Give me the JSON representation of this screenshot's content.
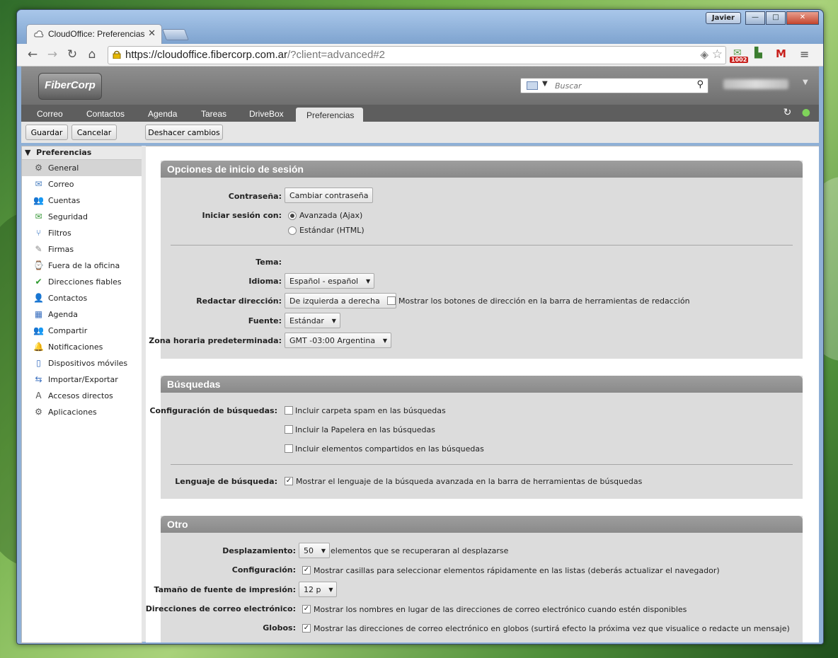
{
  "window": {
    "user_badge": "Javier",
    "min": "—",
    "max": "□",
    "close": "✕"
  },
  "browser": {
    "tab_title": "CloudOffice: Preferencias",
    "tab_close": "✕",
    "url_domain": "https://cloudoffice.fibercorp.com.ar",
    "url_rest": "/?client=advanced#2",
    "ext_badge": "1002"
  },
  "app": {
    "logo": "FiberCorp",
    "search_placeholder": "Buscar",
    "nav_tabs": [
      "Correo",
      "Contactos",
      "Agenda",
      "Tareas",
      "DriveBox",
      "Preferencias"
    ],
    "actions": {
      "save": "Guardar",
      "cancel": "Cancelar",
      "undo": "Deshacer cambios"
    }
  },
  "sidebar": {
    "header": "Preferencias",
    "items": [
      {
        "label": "General",
        "icon": "gear-icon",
        "glyph": "⚙"
      },
      {
        "label": "Correo",
        "icon": "mail-icon",
        "glyph": "✉"
      },
      {
        "label": "Cuentas",
        "icon": "accounts-icon",
        "glyph": "👥"
      },
      {
        "label": "Seguridad",
        "icon": "security-icon",
        "glyph": "✉"
      },
      {
        "label": "Filtros",
        "icon": "filter-icon",
        "glyph": "⑂"
      },
      {
        "label": "Firmas",
        "icon": "signature-icon",
        "glyph": "✎"
      },
      {
        "label": "Fuera de la oficina",
        "icon": "out-of-office-icon",
        "glyph": "⌚"
      },
      {
        "label": "Direcciones fiables",
        "icon": "shield-icon",
        "glyph": "✔"
      },
      {
        "label": "Contactos",
        "icon": "contact-icon",
        "glyph": "👤"
      },
      {
        "label": "Agenda",
        "icon": "calendar-icon",
        "glyph": "▦"
      },
      {
        "label": "Compartir",
        "icon": "share-icon",
        "glyph": "👥"
      },
      {
        "label": "Notificaciones",
        "icon": "bell-icon",
        "glyph": "🔔"
      },
      {
        "label": "Dispositivos móviles",
        "icon": "mobile-icon",
        "glyph": "▯"
      },
      {
        "label": "Importar/Exportar",
        "icon": "import-export-icon",
        "glyph": "⇆"
      },
      {
        "label": "Accesos directos",
        "icon": "shortcut-icon",
        "glyph": "A"
      },
      {
        "label": "Aplicaciones",
        "icon": "apps-icon",
        "glyph": "⚙"
      }
    ]
  },
  "login": {
    "title": "Opciones de inicio de sesión",
    "password_label": "Contraseña:",
    "password_button": "Cambiar contraseña",
    "signin_label": "Iniciar sesión con:",
    "signin_advanced": "Avanzada (Ajax)",
    "signin_standard": "Estándar (HTML)",
    "theme_label": "Tema:",
    "language_label": "Idioma:",
    "language_value": "Español - español",
    "direction_label": "Redactar dirección:",
    "direction_value": "De izquierda a derecha",
    "direction_check": "Mostrar los botones de dirección en la barra de herramientas de redacción",
    "font_label": "Fuente:",
    "font_value": "Estándar",
    "timezone_label": "Zona horaria predeterminada:",
    "timezone_value": "GMT -03:00 Argentina"
  },
  "searches": {
    "title": "Búsquedas",
    "config_label": "Configuración de búsquedas:",
    "opt_spam": "Incluir carpeta spam en las búsquedas",
    "opt_trash": "Incluir la Papelera en las búsquedas",
    "opt_shared": "Incluir elementos compartidos en las búsquedas",
    "lang_label": "Lenguaje de búsqueda:",
    "lang_check": "Mostrar el lenguaje de la búsqueda avanzada en la barra de herramientas de búsquedas"
  },
  "other": {
    "title": "Otro",
    "scroll_label": "Desplazamiento:",
    "scroll_value": "50",
    "scroll_text": "elementos que se recuperaran al desplazarse",
    "config_label": "Configuración:",
    "config_check": "Mostrar casillas para seleccionar elementos rápidamente en las listas (deberás actualizar el navegador)",
    "printfont_label": "Tamaño de fuente de impresión:",
    "printfont_value": "12 p",
    "addresses_label": "Direcciones de correo electrónico:",
    "addresses_check": "Mostrar los nombres en lugar de las direcciones de correo electrónico cuando estén disponibles",
    "bubbles_label": "Globos:",
    "bubbles_check": "Mostrar las direcciones de correo electrónico en globos (surtirá efecto la próxima vez que visualice o redacte un mensaje)"
  }
}
